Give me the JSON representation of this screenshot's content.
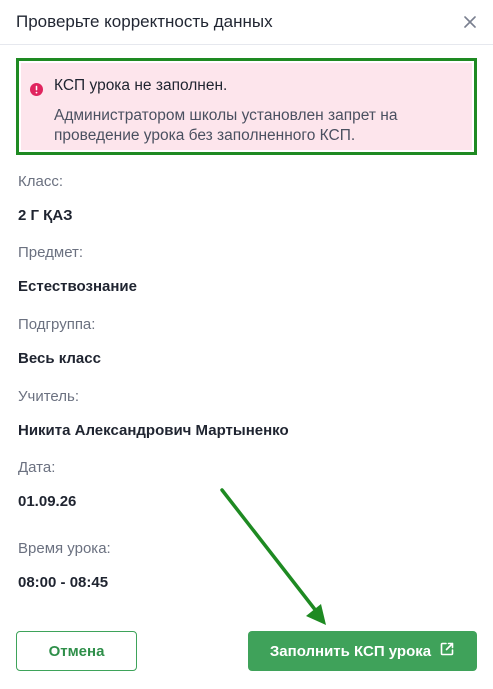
{
  "dialog": {
    "title": "Проверьте корректность данных",
    "close_icon": "close-icon"
  },
  "alert": {
    "icon": "error-circle-icon",
    "title": "КСП урока не заполнен.",
    "text": "Администратором школы установлен запрет на проведение урока без заполненного КСП.",
    "background": "#fde5ec",
    "accent": "#e0245e"
  },
  "fields": [
    {
      "label": "Класс:",
      "value": "2 Г ҚАЗ"
    },
    {
      "label": "Предмет:",
      "value": "Естествознание"
    },
    {
      "label": "Подгруппа:",
      "value": "Весь класс"
    },
    {
      "label": "Учитель:",
      "value": "Никита Александрович Мартыненко"
    },
    {
      "label": "Дата:",
      "value": "01.09.26"
    },
    {
      "label": "Время урока:",
      "value": "08:00 - 08:45"
    }
  ],
  "buttons": {
    "cancel_label": "Отмена",
    "primary_label": "Заполнить КСП урока",
    "primary_icon": "external-link-icon",
    "primary_color": "#3fa25a"
  },
  "annotation": {
    "highlight_color": "#1e8a22"
  }
}
